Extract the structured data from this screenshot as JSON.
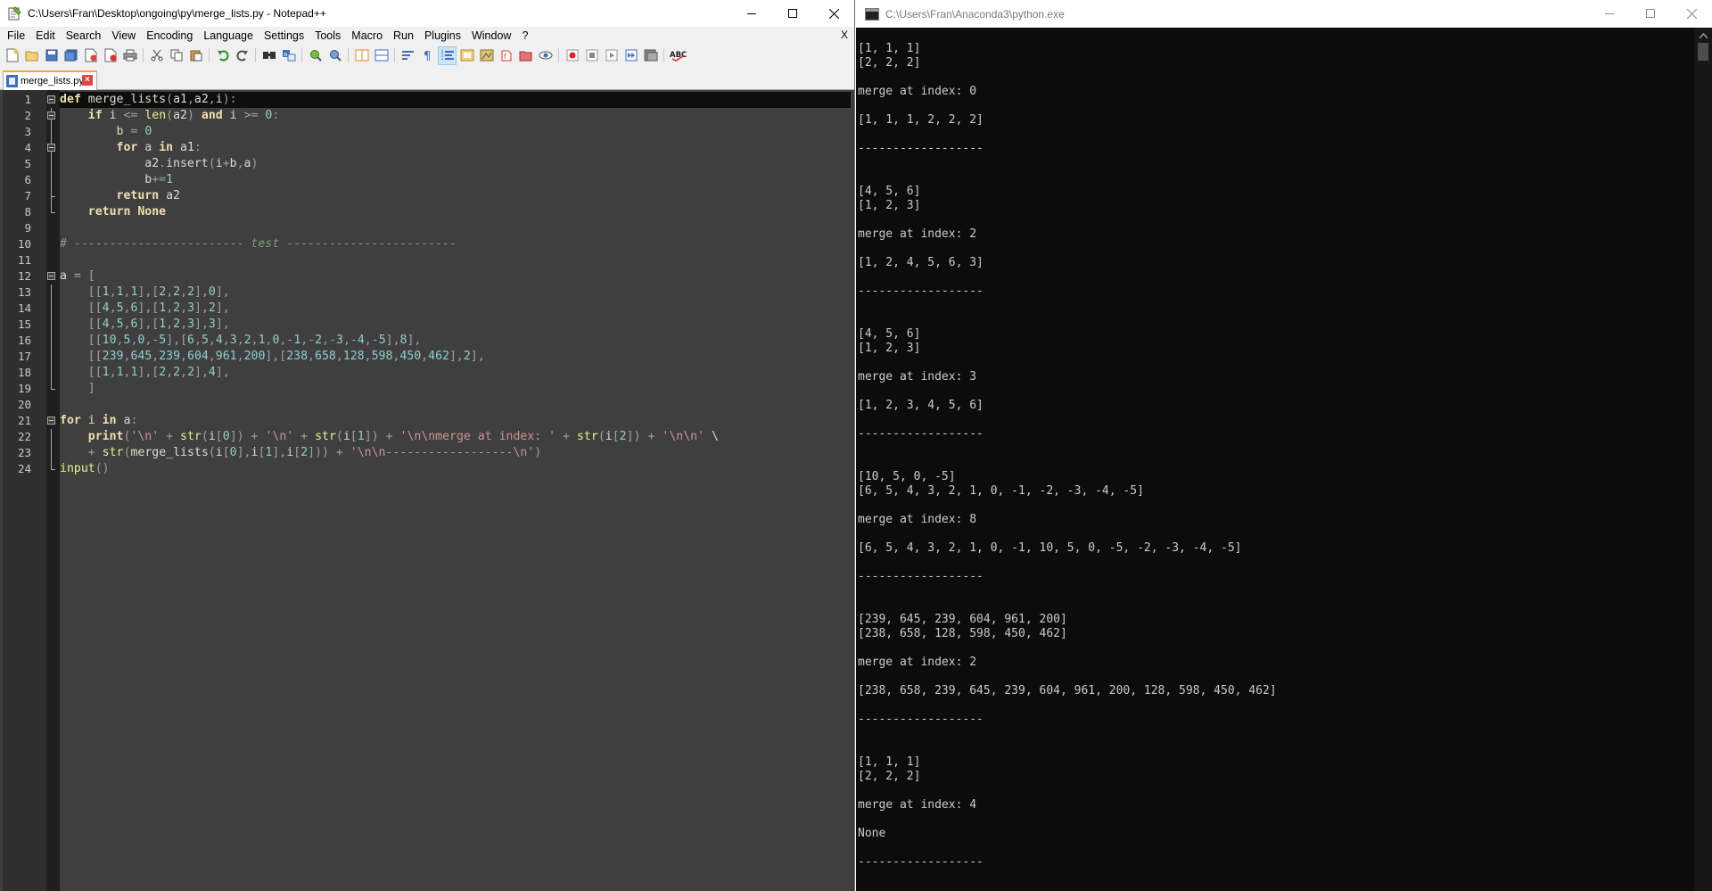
{
  "notepad": {
    "title": "C:\\Users\\Fran\\Desktop\\ongoing\\py\\merge_lists.py - Notepad++",
    "menu": [
      "File",
      "Edit",
      "Search",
      "View",
      "Encoding",
      "Language",
      "Settings",
      "Tools",
      "Macro",
      "Run",
      "Plugins",
      "Window",
      "?"
    ],
    "menu_close": "X",
    "tab_label": "merge_lists.py",
    "tab_close": "×",
    "toolbar_spell_label": "ABC",
    "code_lines": [
      [
        [
          "kw",
          "def"
        ],
        [
          "nm",
          " merge_lists"
        ],
        [
          "op",
          "("
        ],
        [
          "nm",
          "a1"
        ],
        [
          "op",
          ","
        ],
        [
          "nm",
          "a2"
        ],
        [
          "op",
          ","
        ],
        [
          "nm",
          "i"
        ],
        [
          "op",
          "):"
        ]
      ],
      [
        [
          "nm",
          "    "
        ],
        [
          "kw",
          "if"
        ],
        [
          "nm",
          " i "
        ],
        [
          "op",
          "<="
        ],
        [
          "nm",
          " "
        ],
        [
          "bi",
          "len"
        ],
        [
          "op",
          "("
        ],
        [
          "nm",
          "a2"
        ],
        [
          "op",
          ")"
        ],
        [
          "nm",
          " "
        ],
        [
          "kw",
          "and"
        ],
        [
          "nm",
          " i "
        ],
        [
          "op",
          ">="
        ],
        [
          "nm",
          " "
        ],
        [
          "num",
          "0"
        ],
        [
          "op",
          ":"
        ]
      ],
      [
        [
          "nm",
          "        b "
        ],
        [
          "op",
          "="
        ],
        [
          "nm",
          " "
        ],
        [
          "num",
          "0"
        ]
      ],
      [
        [
          "nm",
          "        "
        ],
        [
          "kw",
          "for"
        ],
        [
          "nm",
          " a "
        ],
        [
          "kw",
          "in"
        ],
        [
          "nm",
          " a1"
        ],
        [
          "op",
          ":"
        ]
      ],
      [
        [
          "nm",
          "            a2"
        ],
        [
          "op",
          "."
        ],
        [
          "nm",
          "insert"
        ],
        [
          "op",
          "("
        ],
        [
          "nm",
          "i"
        ],
        [
          "op",
          "+"
        ],
        [
          "nm",
          "b"
        ],
        [
          "op",
          ","
        ],
        [
          "nm",
          "a"
        ],
        [
          "op",
          ")"
        ]
      ],
      [
        [
          "nm",
          "            b"
        ],
        [
          "op",
          "+="
        ],
        [
          "num",
          "1"
        ]
      ],
      [
        [
          "nm",
          "        "
        ],
        [
          "kw",
          "return"
        ],
        [
          "nm",
          " a2"
        ]
      ],
      [
        [
          "nm",
          "    "
        ],
        [
          "kw",
          "return"
        ],
        [
          "nm",
          " "
        ],
        [
          "kw",
          "None"
        ]
      ],
      [],
      [
        [
          "cmt",
          "# ------------------------ "
        ],
        [
          "cmt-i",
          "test"
        ],
        [
          "cmt",
          " ------------------------"
        ]
      ],
      [],
      [
        [
          "nm",
          "a "
        ],
        [
          "op",
          "="
        ],
        [
          "nm",
          " "
        ],
        [
          "op",
          "["
        ]
      ],
      [
        [
          "nm",
          "    "
        ],
        [
          "op",
          "[["
        ],
        [
          "num",
          "1"
        ],
        [
          "op",
          ","
        ],
        [
          "num",
          "1"
        ],
        [
          "op",
          ","
        ],
        [
          "num",
          "1"
        ],
        [
          "op",
          "],["
        ],
        [
          "num",
          "2"
        ],
        [
          "op",
          ","
        ],
        [
          "num",
          "2"
        ],
        [
          "op",
          ","
        ],
        [
          "num",
          "2"
        ],
        [
          "op",
          "],"
        ],
        [
          "num",
          "0"
        ],
        [
          "op",
          "],"
        ]
      ],
      [
        [
          "nm",
          "    "
        ],
        [
          "op",
          "[["
        ],
        [
          "num",
          "4"
        ],
        [
          "op",
          ","
        ],
        [
          "num",
          "5"
        ],
        [
          "op",
          ","
        ],
        [
          "num",
          "6"
        ],
        [
          "op",
          "],["
        ],
        [
          "num",
          "1"
        ],
        [
          "op",
          ","
        ],
        [
          "num",
          "2"
        ],
        [
          "op",
          ","
        ],
        [
          "num",
          "3"
        ],
        [
          "op",
          "],"
        ],
        [
          "num",
          "2"
        ],
        [
          "op",
          "],"
        ]
      ],
      [
        [
          "nm",
          "    "
        ],
        [
          "op",
          "[["
        ],
        [
          "num",
          "4"
        ],
        [
          "op",
          ","
        ],
        [
          "num",
          "5"
        ],
        [
          "op",
          ","
        ],
        [
          "num",
          "6"
        ],
        [
          "op",
          "],["
        ],
        [
          "num",
          "1"
        ],
        [
          "op",
          ","
        ],
        [
          "num",
          "2"
        ],
        [
          "op",
          ","
        ],
        [
          "num",
          "3"
        ],
        [
          "op",
          "],"
        ],
        [
          "num",
          "3"
        ],
        [
          "op",
          "],"
        ]
      ],
      [
        [
          "nm",
          "    "
        ],
        [
          "op",
          "[["
        ],
        [
          "num",
          "10"
        ],
        [
          "op",
          ","
        ],
        [
          "num",
          "5"
        ],
        [
          "op",
          ","
        ],
        [
          "num",
          "0"
        ],
        [
          "op",
          ",-"
        ],
        [
          "num",
          "5"
        ],
        [
          "op",
          "],["
        ],
        [
          "num",
          "6"
        ],
        [
          "op",
          ","
        ],
        [
          "num",
          "5"
        ],
        [
          "op",
          ","
        ],
        [
          "num",
          "4"
        ],
        [
          "op",
          ","
        ],
        [
          "num",
          "3"
        ],
        [
          "op",
          ","
        ],
        [
          "num",
          "2"
        ],
        [
          "op",
          ","
        ],
        [
          "num",
          "1"
        ],
        [
          "op",
          ","
        ],
        [
          "num",
          "0"
        ],
        [
          "op",
          ",-"
        ],
        [
          "num",
          "1"
        ],
        [
          "op",
          ",-"
        ],
        [
          "num",
          "2"
        ],
        [
          "op",
          ",-"
        ],
        [
          "num",
          "3"
        ],
        [
          "op",
          ",-"
        ],
        [
          "num",
          "4"
        ],
        [
          "op",
          ",-"
        ],
        [
          "num",
          "5"
        ],
        [
          "op",
          "],"
        ],
        [
          "num",
          "8"
        ],
        [
          "op",
          "],"
        ]
      ],
      [
        [
          "nm",
          "    "
        ],
        [
          "op",
          "[["
        ],
        [
          "num",
          "239"
        ],
        [
          "op",
          ","
        ],
        [
          "num",
          "645"
        ],
        [
          "op",
          ","
        ],
        [
          "num",
          "239"
        ],
        [
          "op",
          ","
        ],
        [
          "num",
          "604"
        ],
        [
          "op",
          ","
        ],
        [
          "num",
          "961"
        ],
        [
          "op",
          ","
        ],
        [
          "num",
          "200"
        ],
        [
          "op",
          "],["
        ],
        [
          "num",
          "238"
        ],
        [
          "op",
          ","
        ],
        [
          "num",
          "658"
        ],
        [
          "op",
          ","
        ],
        [
          "num",
          "128"
        ],
        [
          "op",
          ","
        ],
        [
          "num",
          "598"
        ],
        [
          "op",
          ","
        ],
        [
          "num",
          "450"
        ],
        [
          "op",
          ","
        ],
        [
          "num",
          "462"
        ],
        [
          "op",
          "],"
        ],
        [
          "num",
          "2"
        ],
        [
          "op",
          "],"
        ]
      ],
      [
        [
          "nm",
          "    "
        ],
        [
          "op",
          "[["
        ],
        [
          "num",
          "1"
        ],
        [
          "op",
          ","
        ],
        [
          "num",
          "1"
        ],
        [
          "op",
          ","
        ],
        [
          "num",
          "1"
        ],
        [
          "op",
          "],["
        ],
        [
          "num",
          "2"
        ],
        [
          "op",
          ","
        ],
        [
          "num",
          "2"
        ],
        [
          "op",
          ","
        ],
        [
          "num",
          "2"
        ],
        [
          "op",
          "],"
        ],
        [
          "num",
          "4"
        ],
        [
          "op",
          "],"
        ]
      ],
      [
        [
          "nm",
          "    "
        ],
        [
          "op",
          "]"
        ]
      ],
      [],
      [
        [
          "kw",
          "for"
        ],
        [
          "nm",
          " i "
        ],
        [
          "kw",
          "in"
        ],
        [
          "nm",
          " a"
        ],
        [
          "op",
          ":"
        ]
      ],
      [
        [
          "nm",
          "    "
        ],
        [
          "kw",
          "print"
        ],
        [
          "op",
          "("
        ],
        [
          "str",
          "'\\n'"
        ],
        [
          "nm",
          " "
        ],
        [
          "op",
          "+"
        ],
        [
          "nm",
          " "
        ],
        [
          "bi",
          "str"
        ],
        [
          "op",
          "("
        ],
        [
          "nm",
          "i"
        ],
        [
          "op",
          "["
        ],
        [
          "num",
          "0"
        ],
        [
          "op",
          "])"
        ],
        [
          "nm",
          " "
        ],
        [
          "op",
          "+"
        ],
        [
          "nm",
          " "
        ],
        [
          "str",
          "'\\n'"
        ],
        [
          "nm",
          " "
        ],
        [
          "op",
          "+"
        ],
        [
          "nm",
          " "
        ],
        [
          "bi",
          "str"
        ],
        [
          "op",
          "("
        ],
        [
          "nm",
          "i"
        ],
        [
          "op",
          "["
        ],
        [
          "num",
          "1"
        ],
        [
          "op",
          "])"
        ],
        [
          "nm",
          " "
        ],
        [
          "op",
          "+"
        ],
        [
          "nm",
          " "
        ],
        [
          "str",
          "'\\n\\nmerge at index: '"
        ],
        [
          "nm",
          " "
        ],
        [
          "op",
          "+"
        ],
        [
          "nm",
          " "
        ],
        [
          "bi",
          "str"
        ],
        [
          "op",
          "("
        ],
        [
          "nm",
          "i"
        ],
        [
          "op",
          "["
        ],
        [
          "num",
          "2"
        ],
        [
          "op",
          "])"
        ],
        [
          "nm",
          " "
        ],
        [
          "op",
          "+"
        ],
        [
          "nm",
          " "
        ],
        [
          "str",
          "'\\n\\n'"
        ],
        [
          "nm",
          " \\"
        ]
      ],
      [
        [
          "nm",
          "    "
        ],
        [
          "op",
          "+"
        ],
        [
          "nm",
          " "
        ],
        [
          "bi",
          "str"
        ],
        [
          "op",
          "("
        ],
        [
          "nm",
          "merge_lists"
        ],
        [
          "op",
          "("
        ],
        [
          "nm",
          "i"
        ],
        [
          "op",
          "["
        ],
        [
          "num",
          "0"
        ],
        [
          "op",
          "],"
        ],
        [
          "nm",
          "i"
        ],
        [
          "op",
          "["
        ],
        [
          "num",
          "1"
        ],
        [
          "op",
          "],"
        ],
        [
          "nm",
          "i"
        ],
        [
          "op",
          "["
        ],
        [
          "num",
          "2"
        ],
        [
          "op",
          "]))"
        ],
        [
          "nm",
          " "
        ],
        [
          "op",
          "+"
        ],
        [
          "nm",
          " "
        ],
        [
          "str",
          "'\\n\\n------------------\\n'"
        ],
        [
          "op",
          ")"
        ]
      ],
      [
        [
          "bi",
          "input"
        ],
        [
          "op",
          "()"
        ]
      ]
    ]
  },
  "console": {
    "title": "C:\\Users\\Fran\\Anaconda3\\python.exe",
    "lines": [
      "[1, 1, 1]",
      "[2, 2, 2]",
      "",
      "merge at index: 0",
      "",
      "[1, 1, 1, 2, 2, 2]",
      "",
      "------------------",
      "",
      "",
      "[4, 5, 6]",
      "[1, 2, 3]",
      "",
      "merge at index: 2",
      "",
      "[1, 2, 4, 5, 6, 3]",
      "",
      "------------------",
      "",
      "",
      "[4, 5, 6]",
      "[1, 2, 3]",
      "",
      "merge at index: 3",
      "",
      "[1, 2, 3, 4, 5, 6]",
      "",
      "------------------",
      "",
      "",
      "[10, 5, 0, -5]",
      "[6, 5, 4, 3, 2, 1, 0, -1, -2, -3, -4, -5]",
      "",
      "merge at index: 8",
      "",
      "[6, 5, 4, 3, 2, 1, 0, -1, 10, 5, 0, -5, -2, -3, -4, -5]",
      "",
      "------------------",
      "",
      "",
      "[239, 645, 239, 604, 961, 200]",
      "[238, 658, 128, 598, 450, 462]",
      "",
      "merge at index: 2",
      "",
      "[238, 658, 239, 645, 239, 604, 961, 200, 128, 598, 450, 462]",
      "",
      "------------------",
      "",
      "",
      "[1, 1, 1]",
      "[2, 2, 2]",
      "",
      "merge at index: 4",
      "",
      "None",
      "",
      "------------------"
    ]
  }
}
